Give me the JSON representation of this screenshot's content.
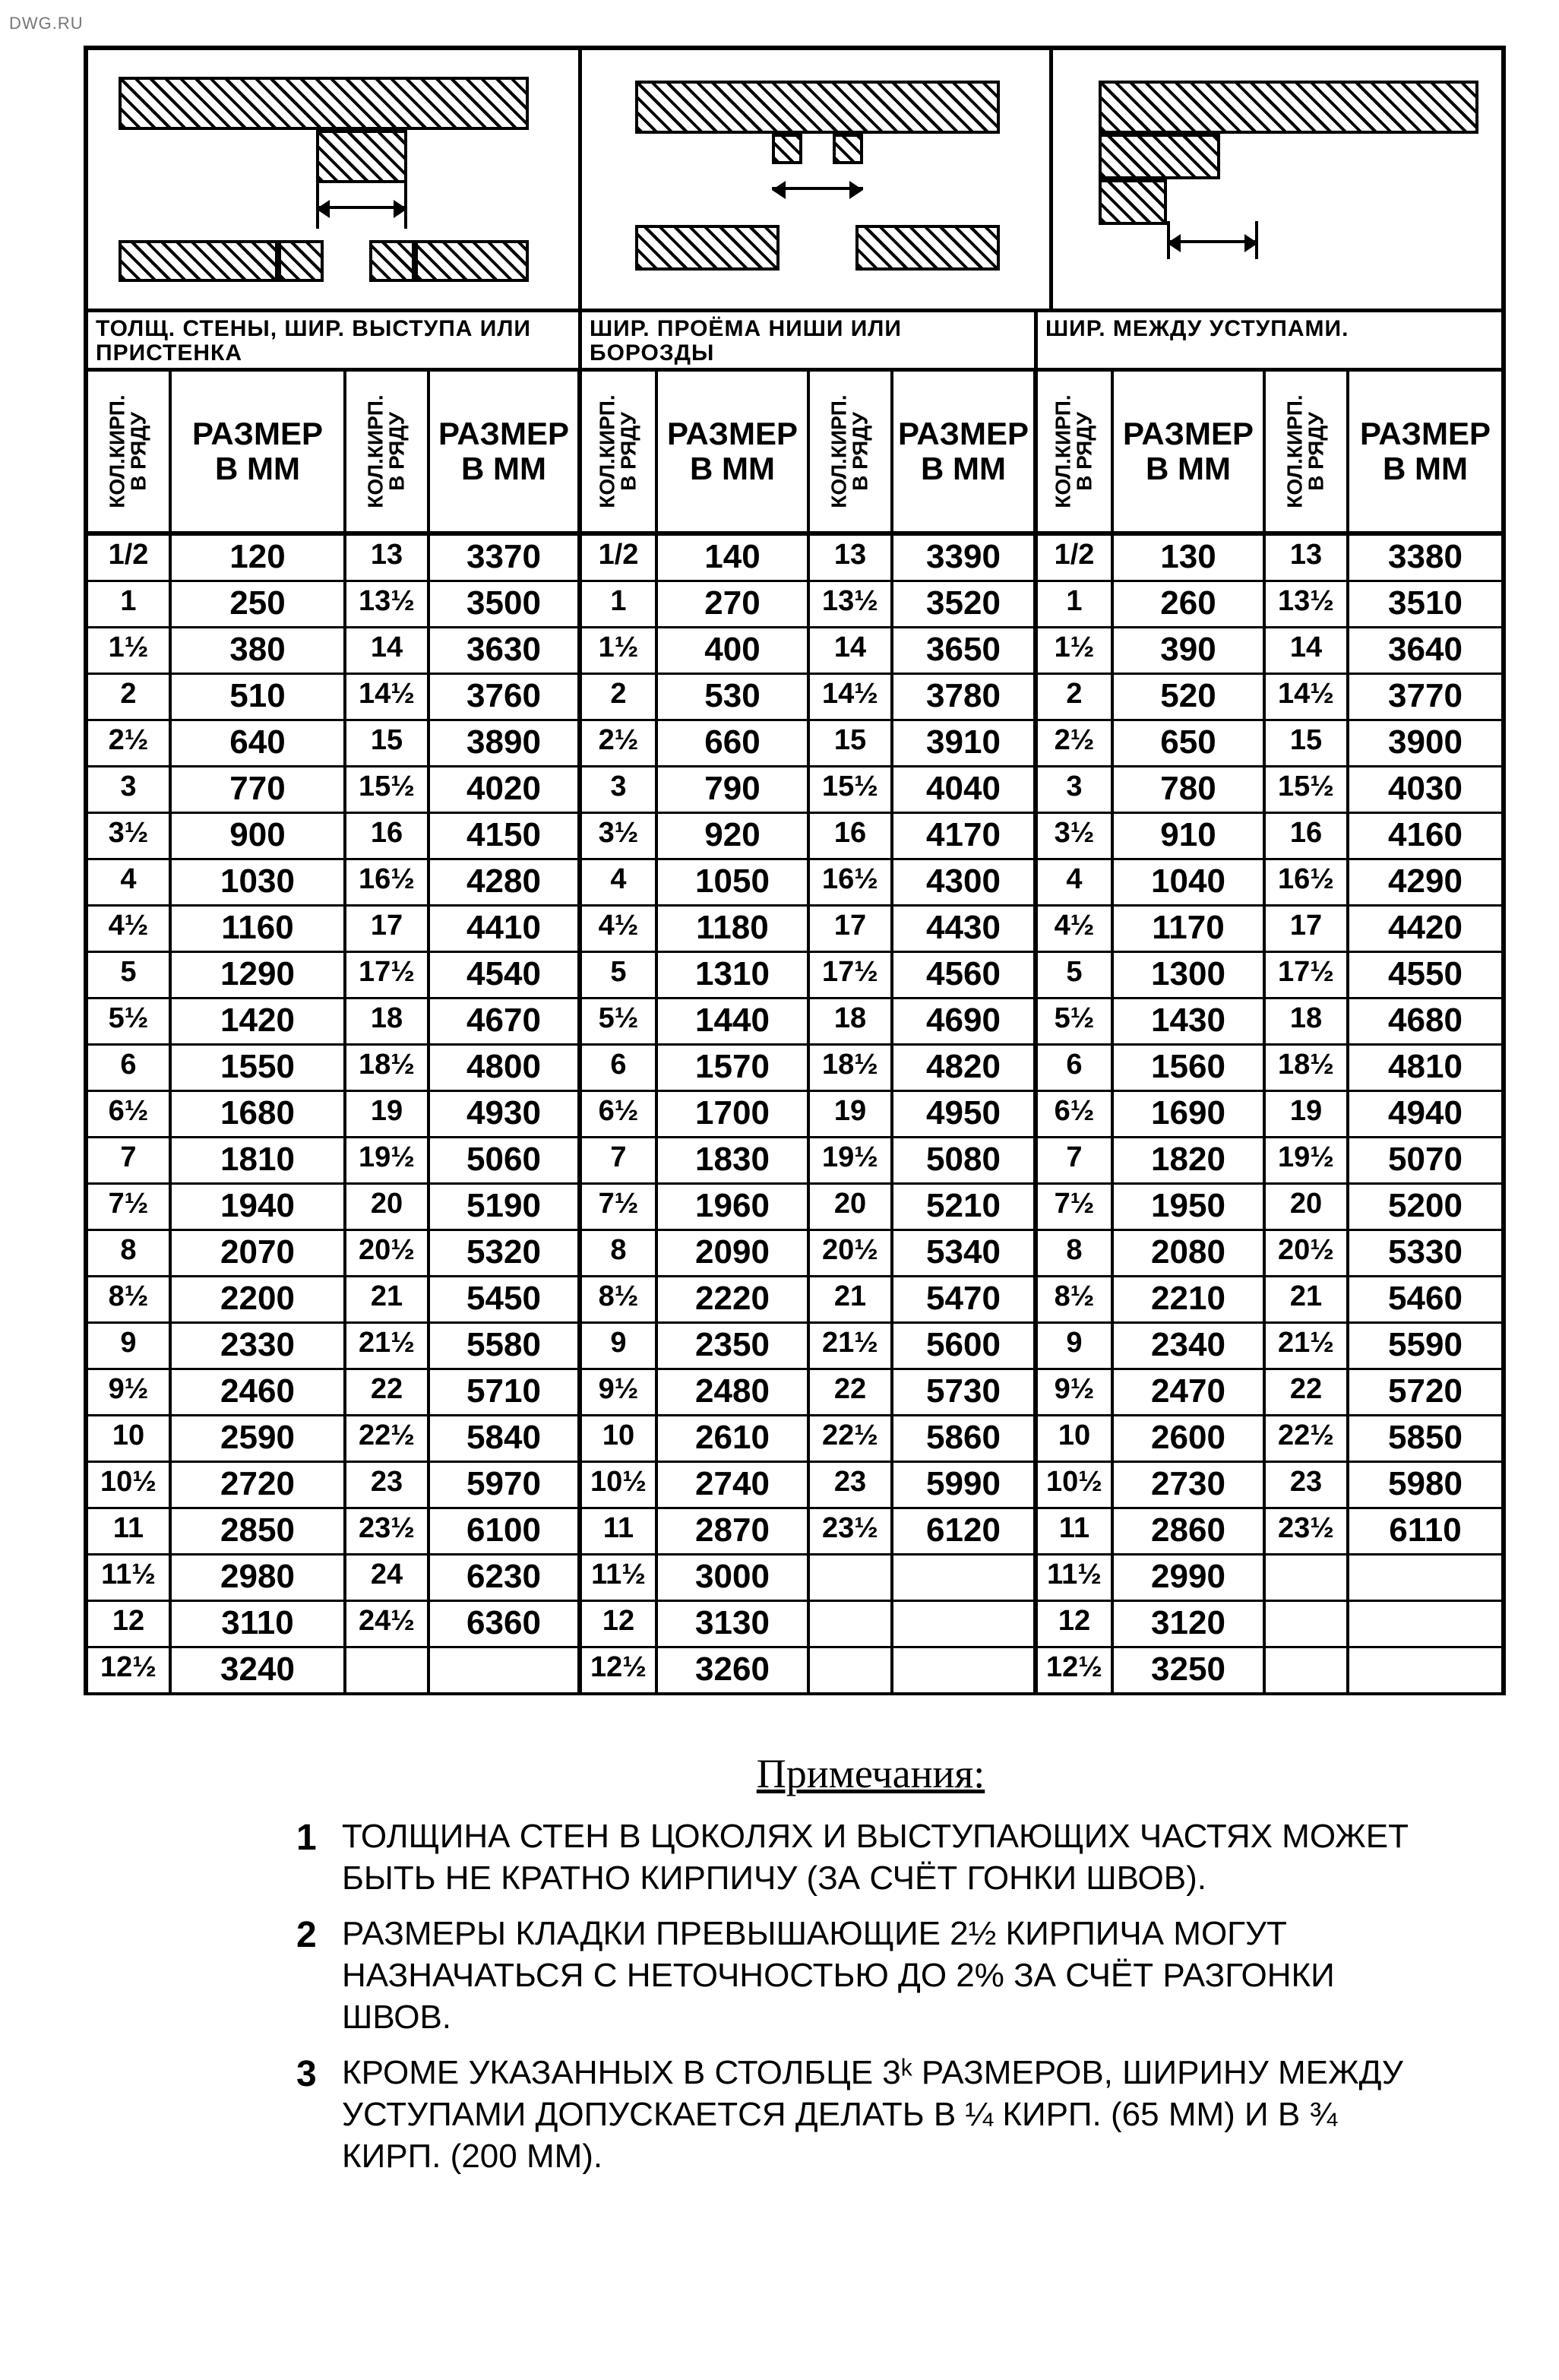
{
  "watermark": "DWG.RU",
  "sections": [
    {
      "title": "ТОЛЩ. СТЕНЫ, ШИР. ВЫСТУПА ИЛИ\nПРИСТЕНКА"
    },
    {
      "title": "ШИР. ПРОЁМА НИШИ ИЛИ БОРОЗДЫ"
    },
    {
      "title": "ШИР. МЕЖДУ   УСТУПАМИ."
    }
  ],
  "col_headers": {
    "kol": "КОЛ.КИРП.\nВ РЯДУ",
    "size": "РАЗМЕР\nВ ММ"
  },
  "chart_data": {
    "type": "table",
    "columns_per_group": [
      "Кол.кирп. в ряду",
      "Размер в мм",
      "Кол.кирп. в ряду",
      "Размер в мм"
    ],
    "groups": [
      "Толщ. стены / выступа",
      "Шир. проёма / ниши / борозды",
      "Шир. между уступами"
    ],
    "rows": [
      [
        [
          "1/2",
          "120",
          "13",
          "3370"
        ],
        [
          "1/2",
          "140",
          "13",
          "3390"
        ],
        [
          "1/2",
          "130",
          "13",
          "3380"
        ]
      ],
      [
        [
          "1",
          "250",
          "13½",
          "3500"
        ],
        [
          "1",
          "270",
          "13½",
          "3520"
        ],
        [
          "1",
          "260",
          "13½",
          "3510"
        ]
      ],
      [
        [
          "1½",
          "380",
          "14",
          "3630"
        ],
        [
          "1½",
          "400",
          "14",
          "3650"
        ],
        [
          "1½",
          "390",
          "14",
          "3640"
        ]
      ],
      [
        [
          "2",
          "510",
          "14½",
          "3760"
        ],
        [
          "2",
          "530",
          "14½",
          "3780"
        ],
        [
          "2",
          "520",
          "14½",
          "3770"
        ]
      ],
      [
        [
          "2½",
          "640",
          "15",
          "3890"
        ],
        [
          "2½",
          "660",
          "15",
          "3910"
        ],
        [
          "2½",
          "650",
          "15",
          "3900"
        ]
      ],
      [
        [
          "3",
          "770",
          "15½",
          "4020"
        ],
        [
          "3",
          "790",
          "15½",
          "4040"
        ],
        [
          "3",
          "780",
          "15½",
          "4030"
        ]
      ],
      [
        [
          "3½",
          "900",
          "16",
          "4150"
        ],
        [
          "3½",
          "920",
          "16",
          "4170"
        ],
        [
          "3½",
          "910",
          "16",
          "4160"
        ]
      ],
      [
        [
          "4",
          "1030",
          "16½",
          "4280"
        ],
        [
          "4",
          "1050",
          "16½",
          "4300"
        ],
        [
          "4",
          "1040",
          "16½",
          "4290"
        ]
      ],
      [
        [
          "4½",
          "1160",
          "17",
          "4410"
        ],
        [
          "4½",
          "1180",
          "17",
          "4430"
        ],
        [
          "4½",
          "1170",
          "17",
          "4420"
        ]
      ],
      [
        [
          "5",
          "1290",
          "17½",
          "4540"
        ],
        [
          "5",
          "1310",
          "17½",
          "4560"
        ],
        [
          "5",
          "1300",
          "17½",
          "4550"
        ]
      ],
      [
        [
          "5½",
          "1420",
          "18",
          "4670"
        ],
        [
          "5½",
          "1440",
          "18",
          "4690"
        ],
        [
          "5½",
          "1430",
          "18",
          "4680"
        ]
      ],
      [
        [
          "6",
          "1550",
          "18½",
          "4800"
        ],
        [
          "6",
          "1570",
          "18½",
          "4820"
        ],
        [
          "6",
          "1560",
          "18½",
          "4810"
        ]
      ],
      [
        [
          "6½",
          "1680",
          "19",
          "4930"
        ],
        [
          "6½",
          "1700",
          "19",
          "4950"
        ],
        [
          "6½",
          "1690",
          "19",
          "4940"
        ]
      ],
      [
        [
          "7",
          "1810",
          "19½",
          "5060"
        ],
        [
          "7",
          "1830",
          "19½",
          "5080"
        ],
        [
          "7",
          "1820",
          "19½",
          "5070"
        ]
      ],
      [
        [
          "7½",
          "1940",
          "20",
          "5190"
        ],
        [
          "7½",
          "1960",
          "20",
          "5210"
        ],
        [
          "7½",
          "1950",
          "20",
          "5200"
        ]
      ],
      [
        [
          "8",
          "2070",
          "20½",
          "5320"
        ],
        [
          "8",
          "2090",
          "20½",
          "5340"
        ],
        [
          "8",
          "2080",
          "20½",
          "5330"
        ]
      ],
      [
        [
          "8½",
          "2200",
          "21",
          "5450"
        ],
        [
          "8½",
          "2220",
          "21",
          "5470"
        ],
        [
          "8½",
          "2210",
          "21",
          "5460"
        ]
      ],
      [
        [
          "9",
          "2330",
          "21½",
          "5580"
        ],
        [
          "9",
          "2350",
          "21½",
          "5600"
        ],
        [
          "9",
          "2340",
          "21½",
          "5590"
        ]
      ],
      [
        [
          "9½",
          "2460",
          "22",
          "5710"
        ],
        [
          "9½",
          "2480",
          "22",
          "5730"
        ],
        [
          "9½",
          "2470",
          "22",
          "5720"
        ]
      ],
      [
        [
          "10",
          "2590",
          "22½",
          "5840"
        ],
        [
          "10",
          "2610",
          "22½",
          "5860"
        ],
        [
          "10",
          "2600",
          "22½",
          "5850"
        ]
      ],
      [
        [
          "10½",
          "2720",
          "23",
          "5970"
        ],
        [
          "10½",
          "2740",
          "23",
          "5990"
        ],
        [
          "10½",
          "2730",
          "23",
          "5980"
        ]
      ],
      [
        [
          "11",
          "2850",
          "23½",
          "6100"
        ],
        [
          "11",
          "2870",
          "23½",
          "6120"
        ],
        [
          "11",
          "2860",
          "23½",
          "6110"
        ]
      ],
      [
        [
          "11½",
          "2980",
          "24",
          "6230"
        ],
        [
          "11½",
          "3000",
          "",
          ""
        ],
        [
          "11½",
          "2990",
          "",
          ""
        ]
      ],
      [
        [
          "12",
          "3110",
          "24½",
          "6360"
        ],
        [
          "12",
          "3130",
          "",
          ""
        ],
        [
          "12",
          "3120",
          "",
          ""
        ]
      ],
      [
        [
          "12½",
          "3240",
          "",
          ""
        ],
        [
          "12½",
          "3260",
          "",
          ""
        ],
        [
          "12½",
          "3250",
          "",
          ""
        ]
      ]
    ]
  },
  "notes": {
    "title": "Примечания:",
    "items": [
      "Толщина стен в цоколях и выступающих частях может быть не кратно кирпичу (за счёт гонки швов).",
      "Размеры кладки превышающие 2½ кирпича могут назначаться с неточностью до 2% за счёт разгонки швов.",
      "Кроме указанных в столбце 3ᵏ размеров, ширину между уступами допускается делать в ¼ кирп. (65 мм) и в ¾ кирп. (200 мм)."
    ]
  }
}
